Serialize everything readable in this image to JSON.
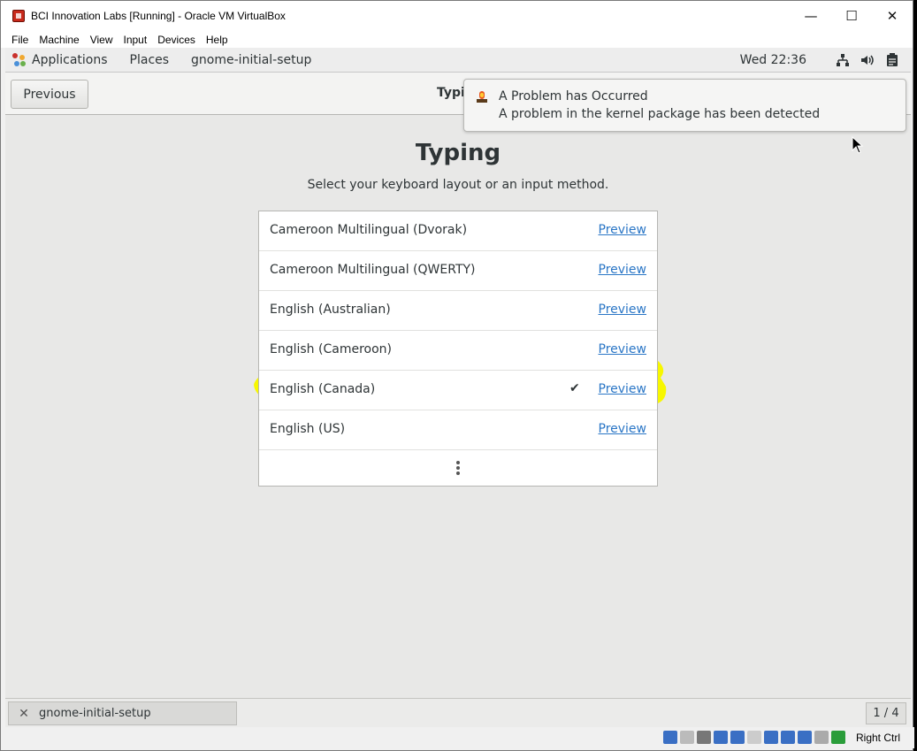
{
  "window": {
    "title": "BCI Innovation Labs [Running] - Oracle VM VirtualBox",
    "minimize_glyph": "—",
    "maximize_glyph": "☐",
    "close_glyph": "✕"
  },
  "menubar": {
    "items": [
      "File",
      "Machine",
      "View",
      "Input",
      "Devices",
      "Help"
    ]
  },
  "gnome_topbar": {
    "applications": "Applications",
    "places": "Places",
    "app_name": "gnome-initial-setup",
    "clock": "Wed 22:36",
    "icons": [
      "network-icon",
      "volume-icon",
      "clipboard-icon"
    ]
  },
  "headerbar": {
    "previous_label": "Previous",
    "title": "Typi"
  },
  "notification": {
    "title": "A Problem has Occurred",
    "body": "A problem in the kernel package has been detected",
    "icon": "alert-icon"
  },
  "page": {
    "title": "Typing",
    "subtitle": "Select your keyboard layout or an input method."
  },
  "layouts": [
    {
      "label": "Cameroon Multilingual (Dvorak)",
      "preview": "Preview",
      "selected": false
    },
    {
      "label": "Cameroon Multilingual (QWERTY)",
      "preview": "Preview",
      "selected": false
    },
    {
      "label": "English (Australian)",
      "preview": "Preview",
      "selected": false
    },
    {
      "label": "English (Cameroon)",
      "preview": "Preview",
      "selected": false
    },
    {
      "label": "English (Canada)",
      "preview": "Preview",
      "selected": true
    },
    {
      "label": "English (US)",
      "preview": "Preview",
      "selected": false
    }
  ],
  "check_glyph": "✔",
  "highlight_color": "#f7f700",
  "taskbar": {
    "task_label": "gnome-initial-setup",
    "workspace": "1 / 4"
  },
  "statusbar": {
    "host_key": "Right Ctrl"
  }
}
